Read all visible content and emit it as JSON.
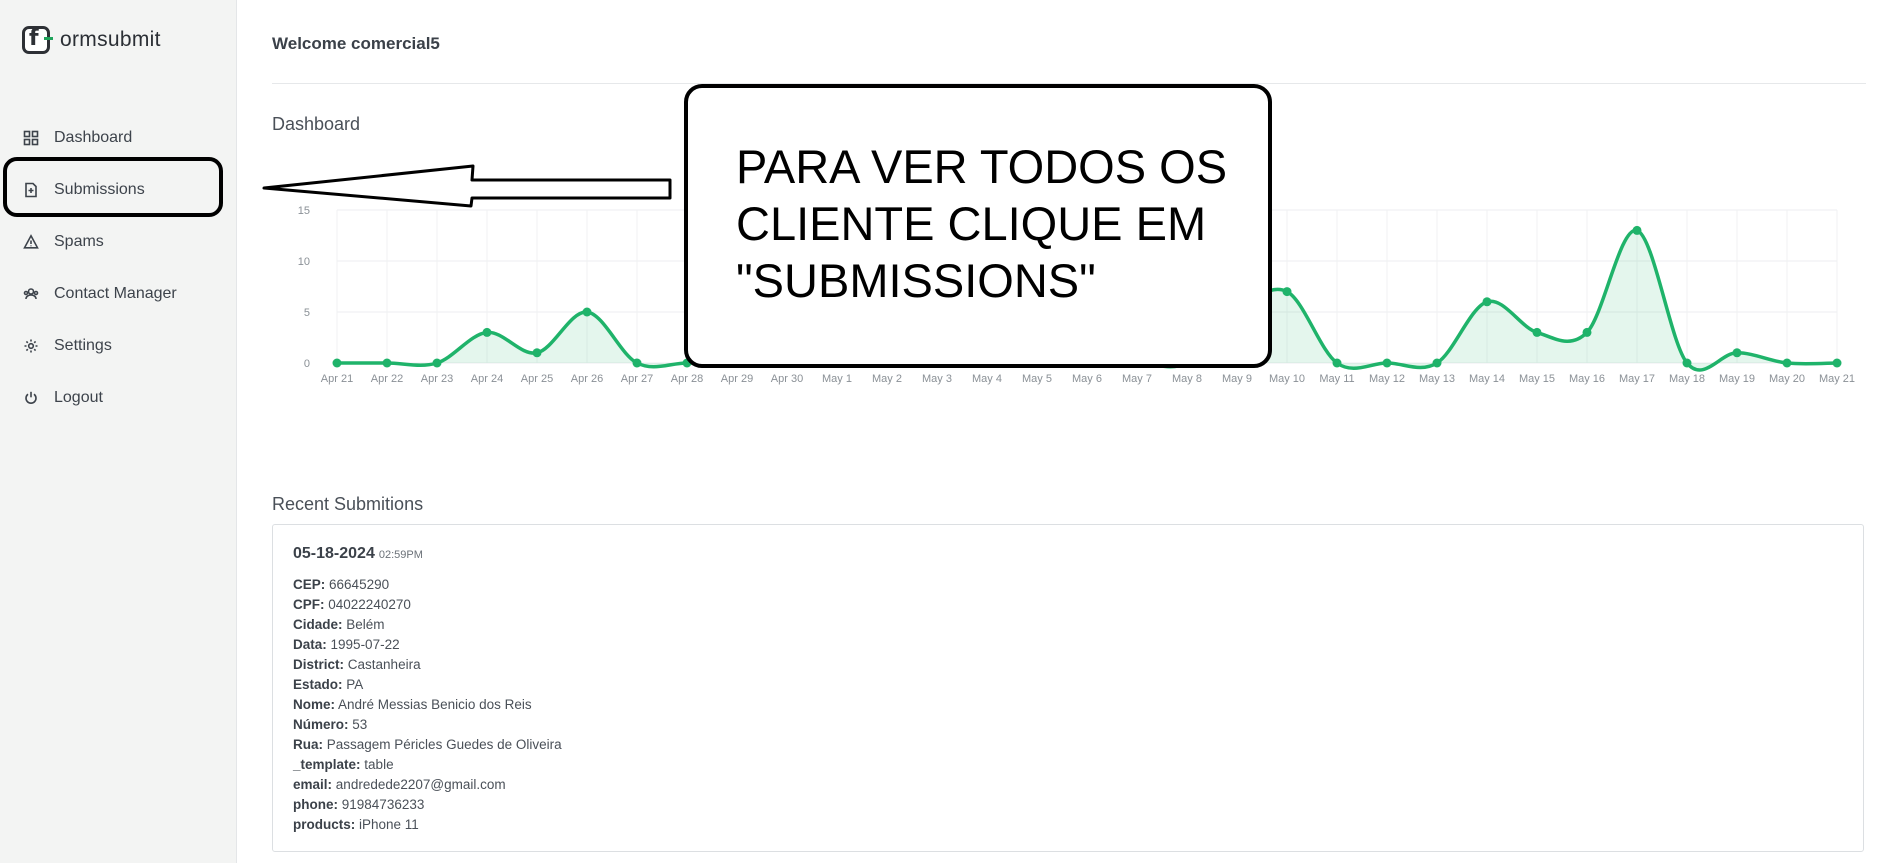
{
  "sidebar": {
    "logo_text": "ormsubmit",
    "items": [
      {
        "label": "Dashboard",
        "icon": "grid-icon"
      },
      {
        "label": "Submissions",
        "icon": "file-plus-icon"
      },
      {
        "label": "Spams",
        "icon": "warning-icon"
      },
      {
        "label": "Contact Manager",
        "icon": "contacts-icon"
      },
      {
        "label": "Settings",
        "icon": "gear-icon"
      },
      {
        "label": "Logout",
        "icon": "power-icon"
      }
    ]
  },
  "header": {
    "welcome": "Welcome comercial5"
  },
  "dashboard": {
    "title": "Dashboard"
  },
  "chart_data": {
    "type": "area",
    "categories": [
      "Apr 21",
      "Apr 22",
      "Apr 23",
      "Apr 24",
      "Apr 25",
      "Apr 26",
      "Apr 27",
      "Apr 28",
      "Apr 29",
      "Apr 30",
      "May 1",
      "May 2",
      "May 3",
      "May 4",
      "May 5",
      "May 6",
      "May 7",
      "May 8",
      "May 9",
      "May 10",
      "May 11",
      "May 12",
      "May 13",
      "May 14",
      "May 15",
      "May 16",
      "May 17",
      "May 18",
      "May 19",
      "May 20",
      "May 21"
    ],
    "values": [
      0,
      0,
      0,
      3,
      1,
      5,
      0,
      0,
      0,
      0,
      0,
      0,
      0,
      0,
      0,
      0,
      0,
      0,
      5,
      7,
      0,
      0,
      0,
      6,
      3,
      3,
      13,
      0,
      1,
      0,
      0
    ],
    "ylim": [
      0,
      15
    ],
    "yticks": [
      "0",
      "5",
      "10",
      "15"
    ],
    "grid": true,
    "color": "#1fb36a"
  },
  "recent": {
    "title": "Recent Submitions",
    "date": "05-18-2024",
    "time": "02:59PM",
    "fields": [
      {
        "k": "CEP:",
        "v": "66645290"
      },
      {
        "k": "CPF:",
        "v": "04022240270"
      },
      {
        "k": "Cidade:",
        "v": "Belém"
      },
      {
        "k": "Data:",
        "v": "1995-07-22"
      },
      {
        "k": "District:",
        "v": "Castanheira"
      },
      {
        "k": "Estado:",
        "v": "PA"
      },
      {
        "k": "Nome:",
        "v": "André Messias Benicio dos Reis"
      },
      {
        "k": "Número:",
        "v": "53"
      },
      {
        "k": "Rua:",
        "v": "Passagem Péricles Guedes de Oliveira"
      },
      {
        "k": "_template:",
        "v": "table"
      },
      {
        "k": "email:",
        "v": "andredede2207@gmail.com"
      },
      {
        "k": "phone:",
        "v": "91984736233"
      },
      {
        "k": "products:",
        "v": "iPhone 11"
      }
    ]
  },
  "annotation": {
    "text": "PARA VER TODOS OS\nCLIENTE CLIQUE EM\n\"SUBMISSIONS\""
  }
}
